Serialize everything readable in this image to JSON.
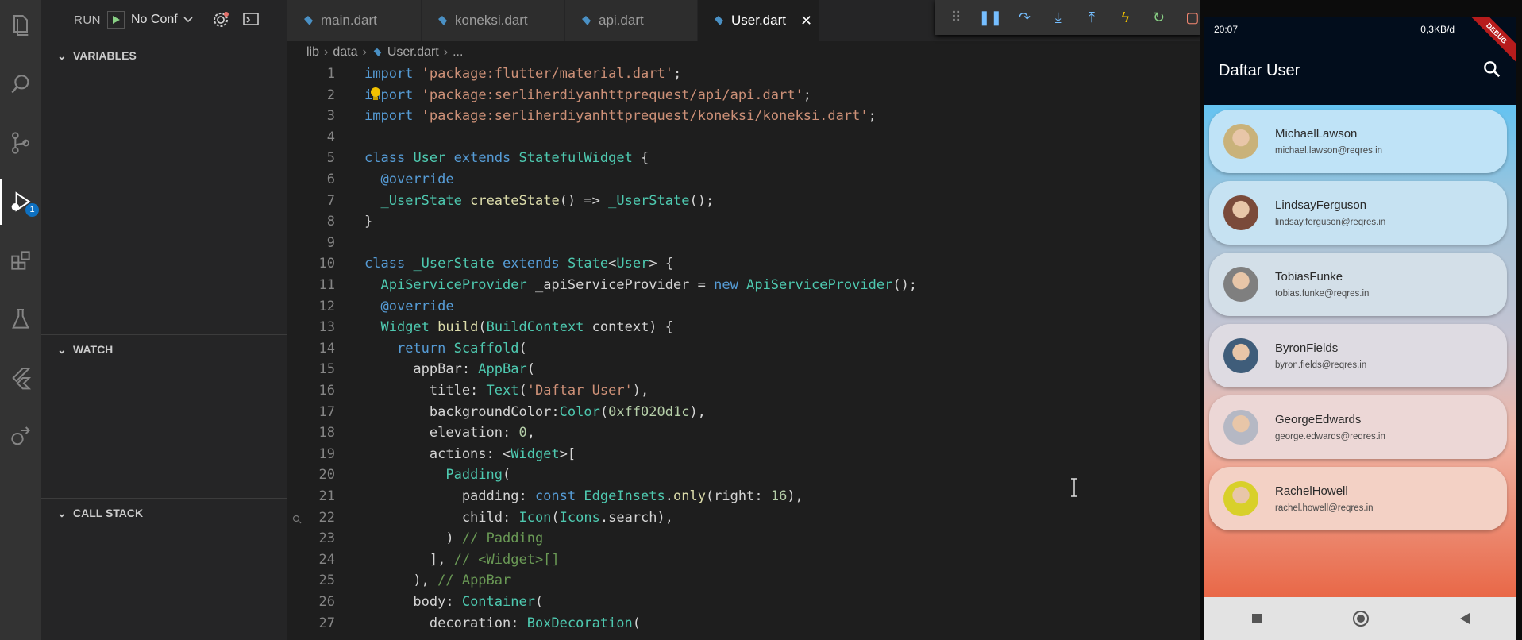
{
  "sidebar": {
    "run_label": "RUN",
    "config": "No Conf",
    "debug_badge": "1",
    "sections": {
      "variables": "VARIABLES",
      "watch": "WATCH",
      "call_stack": "CALL STACK"
    }
  },
  "tabs": [
    {
      "label": "main.dart"
    },
    {
      "label": "koneksi.dart"
    },
    {
      "label": "api.dart"
    },
    {
      "label": "User.dart"
    }
  ],
  "breadcrumb": {
    "folder1": "lib",
    "folder2": "data",
    "file": "User.dart",
    "more": "..."
  },
  "code_lines": [
    "import 'package:flutter/material.dart';",
    "import 'package:serliherdiyanhttprequest/api/api.dart';",
    "import 'package:serliherdiyanhttprequest/koneksi/koneksi.dart';",
    "",
    "class User extends StatefulWidget {",
    "  @override",
    "  _UserState createState() => _UserState();",
    "}",
    "",
    "class _UserState extends State<User> {",
    "  ApiServiceProvider _apiServiceProvider = new ApiServiceProvider();",
    "  @override",
    "  Widget build(BuildContext context) {",
    "    return Scaffold(",
    "      appBar: AppBar(",
    "        title: Text('Daftar User'),",
    "        backgroundColor:Color(0xff020d1c),",
    "        elevation: 0,",
    "        actions: <Widget>[",
    "          Padding(",
    "            padding: const EdgeInsets.only(right: 16),",
    "            child: Icon(Icons.search),",
    "          ) // Padding",
    "        ], // <Widget>[]",
    "      ), // AppBar",
    "      body: Container(",
    "        decoration: BoxDecoration("
  ],
  "phone": {
    "status_time": "20:07",
    "status_right": "0,3KB/d",
    "app_title": "Daftar User",
    "debug_banner": "DEBUG",
    "users": [
      {
        "name": "MichaelLawson",
        "email": "michael.lawson@reqres.in",
        "avatar_color": "#c9b27a",
        "card_color": "#bfe3f7"
      },
      {
        "name": "LindsayFerguson",
        "email": "lindsay.ferguson@reqres.in",
        "avatar_color": "#7a4a3a",
        "card_color": "#c6e2f2"
      },
      {
        "name": "TobiasFunke",
        "email": "tobias.funke@reqres.in",
        "avatar_color": "#7f7f7f",
        "card_color": "#d3dfe8"
      },
      {
        "name": "ByronFields",
        "email": "byron.fields@reqres.in",
        "avatar_color": "#3f5d7a",
        "card_color": "#dedbe2"
      },
      {
        "name": "GeorgeEdwards",
        "email": "george.edwards@reqres.in",
        "avatar_color": "#b5b8c4",
        "card_color": "#ecd7d6"
      },
      {
        "name": "RachelHowell",
        "email": "rachel.howell@reqres.in",
        "avatar_color": "#d8d02a",
        "card_color": "#f3d1c5"
      }
    ]
  }
}
